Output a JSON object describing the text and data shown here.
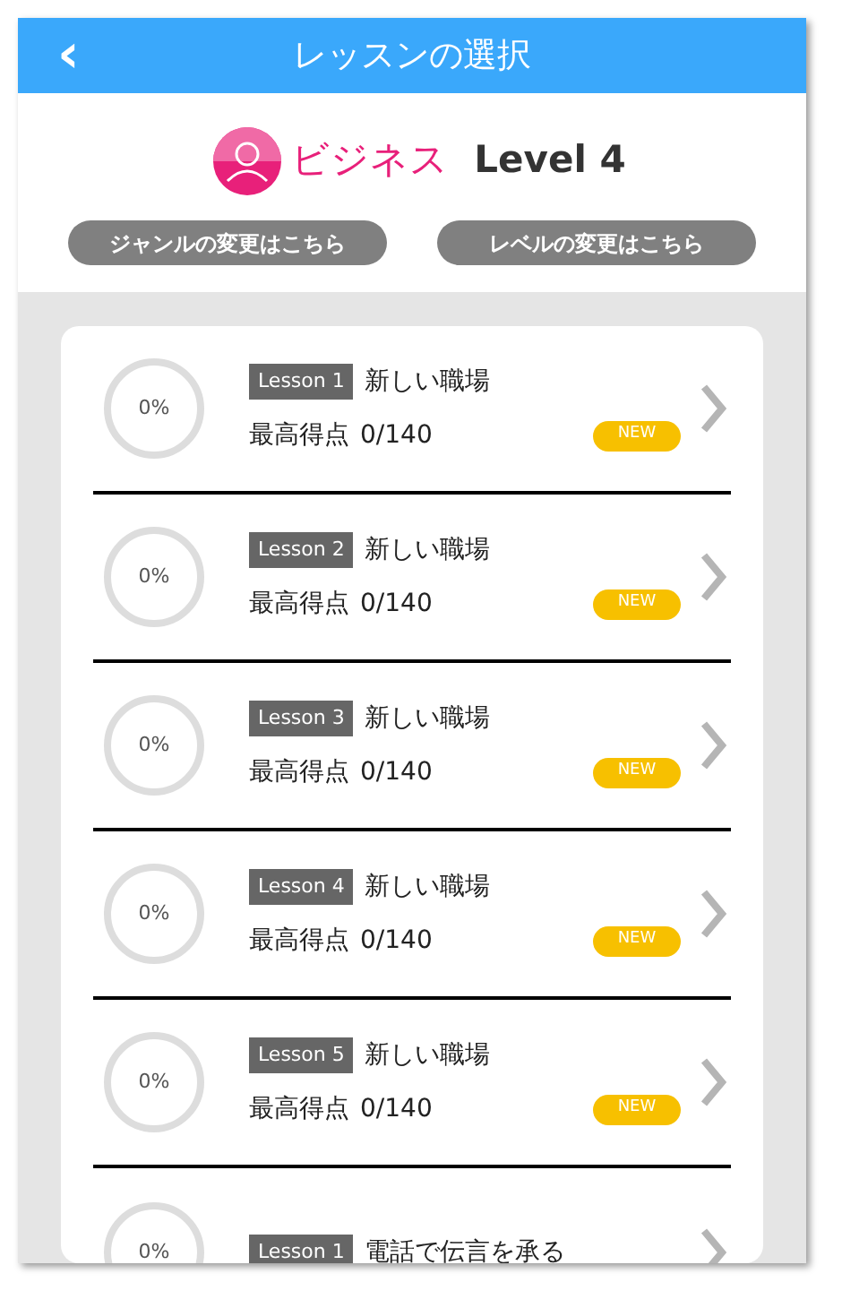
{
  "header": {
    "title": "レッスンの選択",
    "back": "‹"
  },
  "course": {
    "genre": "ビジネス",
    "level": "Level 4"
  },
  "buttons": [
    "ジャンルの変更はこちら",
    "レベルの変更はこちら"
  ],
  "lessons": [
    {
      "progress": "0%",
      "tag": "Lesson 1",
      "title": "新しい職場",
      "score_label": "最高得点",
      "score": "0/140",
      "badge": "NEW"
    },
    {
      "progress": "0%",
      "tag": "Lesson 2",
      "title": "新しい職場",
      "score_label": "最高得点",
      "score": "0/140",
      "badge": "NEW"
    },
    {
      "progress": "0%",
      "tag": "Lesson 3",
      "title": "新しい職場",
      "score_label": "最高得点",
      "score": "0/140",
      "badge": "NEW"
    },
    {
      "progress": "0%",
      "tag": "Lesson 4",
      "title": "新しい職場",
      "score_label": "最高得点",
      "score": "0/140",
      "badge": "NEW"
    },
    {
      "progress": "0%",
      "tag": "Lesson 5",
      "title": "新しい職場",
      "score_label": "最高得点",
      "score": "0/140",
      "badge": "NEW"
    },
    {
      "progress": "0%",
      "tag": "Lesson 1",
      "title": "電話で伝言を承る"
    }
  ]
}
